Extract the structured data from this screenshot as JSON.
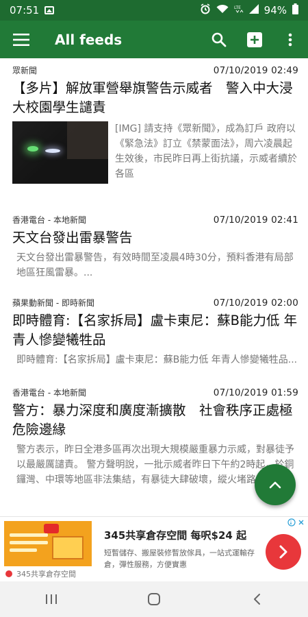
{
  "status_bar": {
    "time": "07:51",
    "battery": "94%",
    "icons": [
      "image-icon",
      "alarm-icon",
      "wifi-icon",
      "lte-icon",
      "signal-icon",
      "battery-icon"
    ]
  },
  "app_bar": {
    "title": "All feeds",
    "actions": [
      "search-icon",
      "add-icon",
      "more-vert-icon"
    ]
  },
  "feed": {
    "items": [
      {
        "source": "眾新聞",
        "date": "07/10/2019 02:49",
        "title": "【多片】解放軍營舉旗警告示威者　警入中大浸大校園學生譴責",
        "snippet": "[IMG] 請支持《眾新聞》，成為訂戶 政府以《緊急法》訂立《禁蒙面法》，周六凌晨起生效後，市民昨日再上街抗議，示威者續於各區",
        "has_thumbnail": true
      },
      {
        "source": "香港電台 - 本地新聞",
        "date": "07/10/2019 02:41",
        "title": "天文台發出雷暴警告",
        "snippet": "天文台發出雷暴警告，有效時間至凌晨4時30分，預料香港有局部地區狂風雷暴。..."
      },
      {
        "source": "蘋果動新聞 - 即時新聞",
        "date": "07/10/2019 02:00",
        "title": "即時體育:【名家拆局】盧卡東尼：蘇B能力低 年青人慘變犧牲品",
        "snippet": "即時體育:【名家拆局】盧卡東尼：蘇B能力低 年青人慘變犧牲品..."
      },
      {
        "source": "香港電台 - 本地新聞",
        "date": "07/10/2019 01:59",
        "title": "警方：暴力深度和廣度漸擴散　社會秩序正處極危險邊緣",
        "snippet": "警方表示，昨日全港多區再次出現大規模嚴重暴力示威，對暴徒予以最嚴厲譴責。 警方聲明說，一批示威者昨日下午約2時起，於銅鑼灣、中環等地區非法集結，有暴徒大肆破壞，縱火堵路，投擲路"
      }
    ]
  },
  "fab": {
    "icon": "chevron-up-icon"
  },
  "ad": {
    "title": "345共享倉存空間 每呎$24 起",
    "description": "短暫儲存、搬屋裝修暫放傢具，一站式運輸存倉，彈性服務，方便實惠",
    "advertiser": "345共享倉存空間",
    "cta_icon": "chevron-right-icon",
    "choices_icon": "ad-choices-icon",
    "close_icon": "close-icon"
  },
  "nav_bar": {
    "buttons": [
      "recent-apps-icon",
      "home-icon",
      "back-icon"
    ]
  },
  "colors": {
    "primary": "#217a37",
    "primary_dark": "#1e6b30",
    "ad_cta": "#e8373b"
  }
}
